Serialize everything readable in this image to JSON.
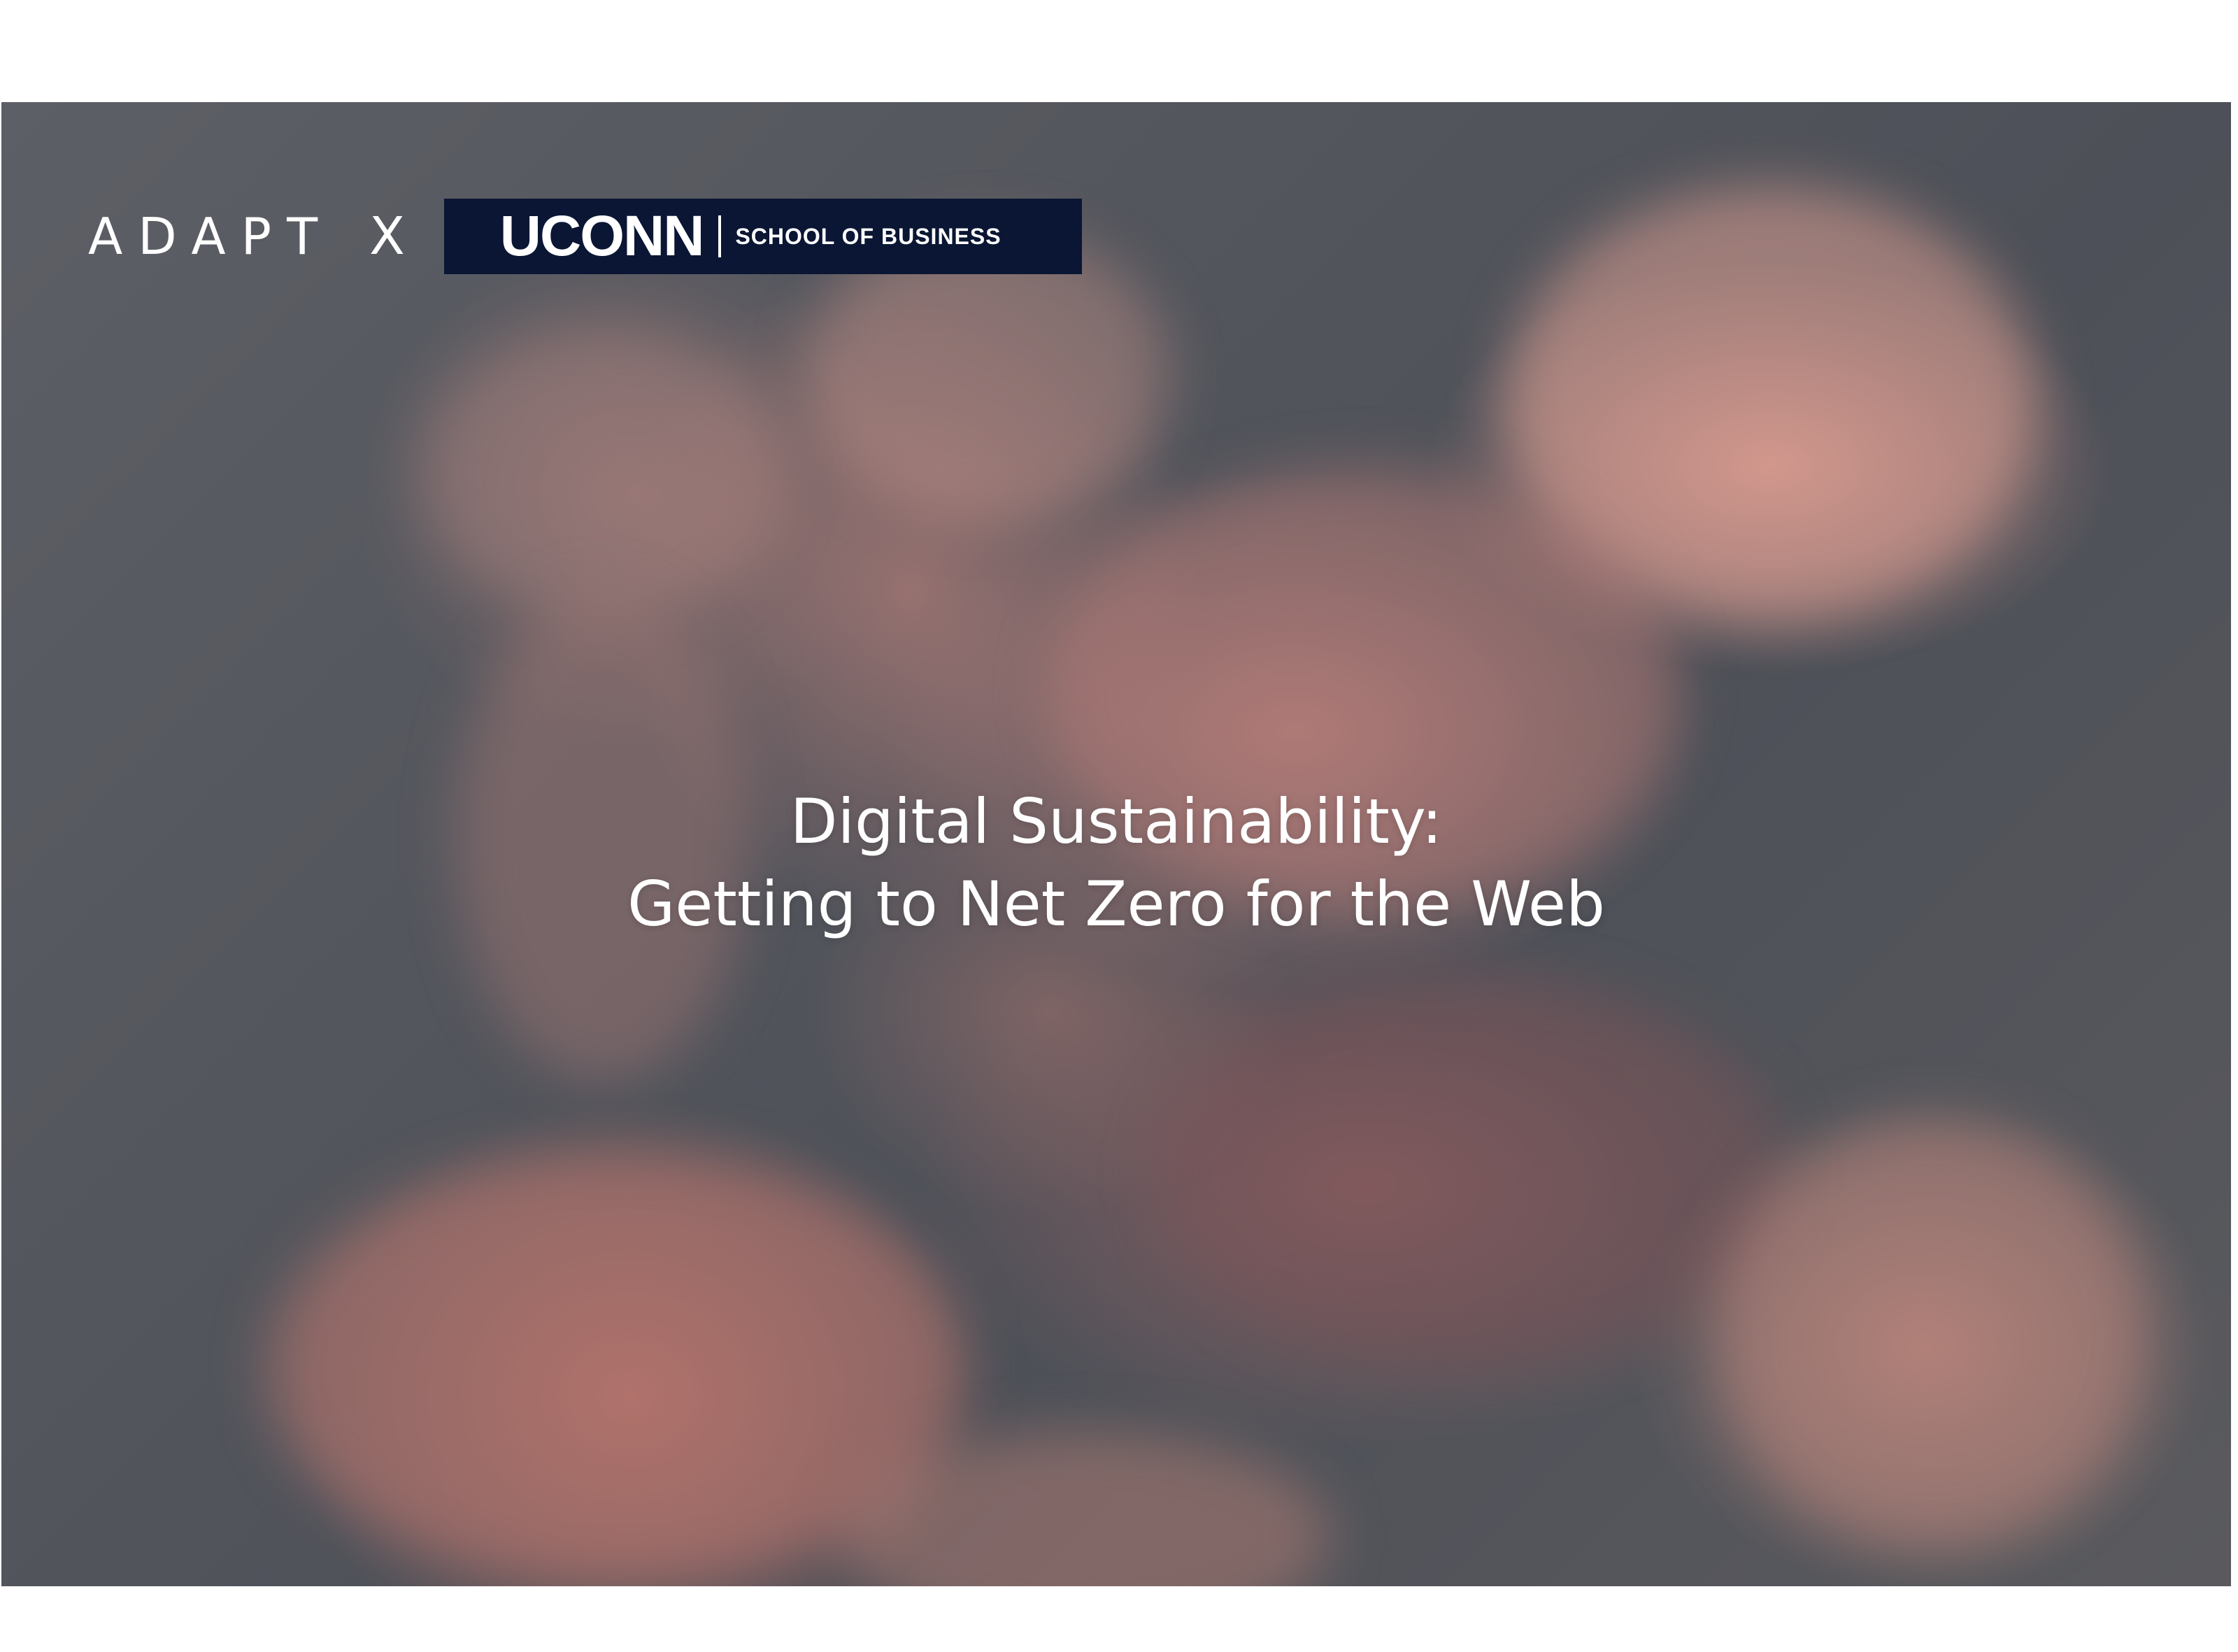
{
  "header": {
    "adapt_logo": "ADAPT",
    "separator": "X",
    "partner": {
      "name": "UCONN",
      "unit": "SCHOOL OF BUSINESS",
      "badge_color": "#0a1633"
    }
  },
  "slide": {
    "title_line_1": "Digital Sustainability:",
    "title_line_2": "Getting to Net Zero for the Web",
    "background": "pink clouds against a grey-blue sky"
  },
  "colors": {
    "text": "#ffffff",
    "sky": "#55575e",
    "cloud": "#d6968c"
  }
}
